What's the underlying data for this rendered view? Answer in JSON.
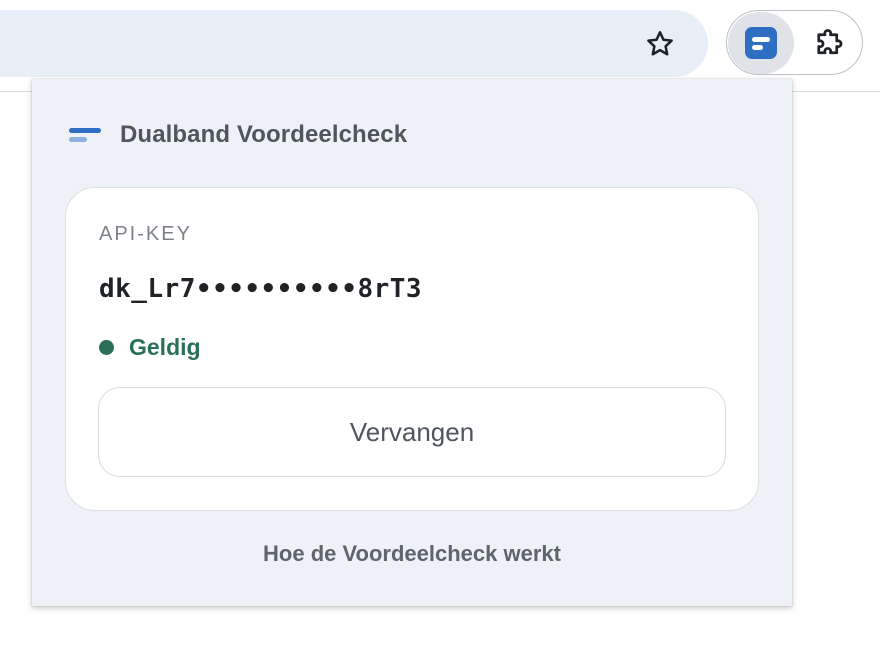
{
  "toolbar": {
    "star_icon": "star-outline-icon",
    "extension_icon": "dualband-logo-icon",
    "puzzle_icon": "puzzle-piece-icon",
    "colors": {
      "omnibox_bg": "#e8eef7",
      "extension_tile": "#2e6fc4"
    }
  },
  "popup": {
    "brand_name": "Dualband Voordeelcheck",
    "card": {
      "label": "API-KEY",
      "key_value": "dk_Lr7••••••••••8rT3",
      "status": "Geldig",
      "status_color": "#2a7057",
      "replace_button": "Vervangen"
    },
    "help_link": "Hoe de Voordeelcheck werkt"
  }
}
